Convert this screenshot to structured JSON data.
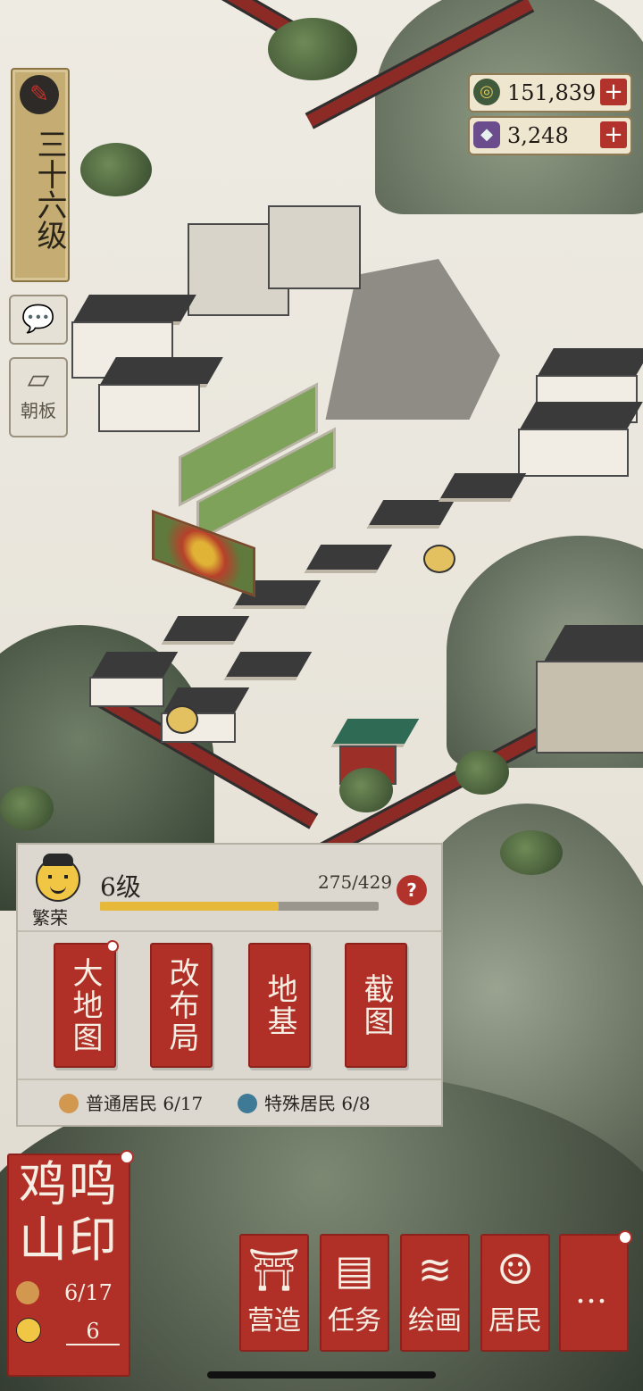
{
  "hud": {
    "level_text": "三十六级",
    "chat_icon": "speech-bubble-icon",
    "board_label": "朝板",
    "gold": {
      "icon": "coin-icon",
      "value": "151,839",
      "add": "+"
    },
    "jade": {
      "icon": "gem-icon",
      "value": "3,248",
      "add": "+"
    }
  },
  "prosperity": {
    "label": "繁荣",
    "level": "6级",
    "progress_text": "275/429",
    "progress_fraction": 0.64,
    "help": "?",
    "actions": [
      {
        "label": "大地图"
      },
      {
        "label": "改布局"
      },
      {
        "label": "地基"
      },
      {
        "label": "截图"
      }
    ],
    "normal_residents": "普通居民 6/17",
    "special_residents": "特殊居民 6/8"
  },
  "seal": {
    "title": "鸡鸣山印",
    "residents": "6/17",
    "level": "6"
  },
  "menu": [
    {
      "label": "营造",
      "icon": "pavilion-icon"
    },
    {
      "label": "任务",
      "icon": "book-icon"
    },
    {
      "label": "绘画",
      "icon": "scroll-icon"
    },
    {
      "label": "居民",
      "icon": "person-icon"
    },
    {
      "label": "…",
      "icon": "more-icon"
    }
  ],
  "colors": {
    "seal_red": "#b03028",
    "panel": "#dcd8d0",
    "gold_bar": "#e6b93b",
    "banner": "#c4ac73"
  }
}
